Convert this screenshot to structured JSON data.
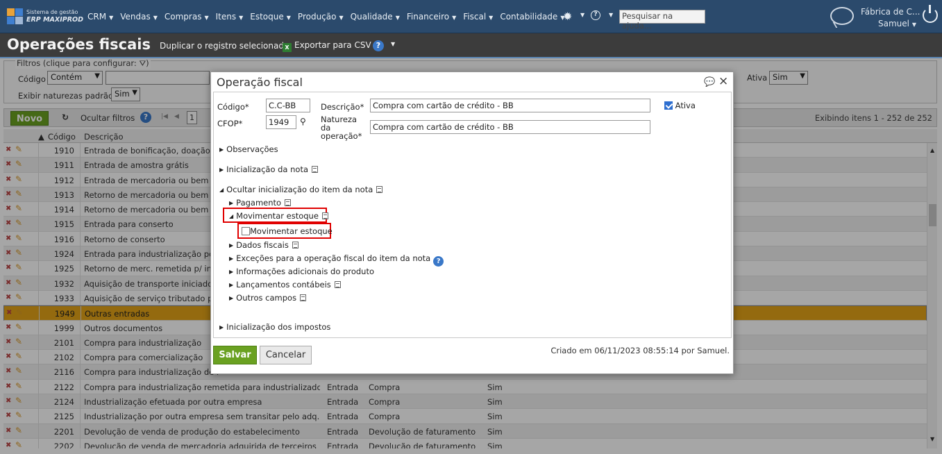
{
  "app": {
    "brand_line1": "Sistema de gestão",
    "brand_line2": "ERP MAXIPROD",
    "menu": [
      "CRM",
      "Vendas",
      "Compras",
      "Itens",
      "Estoque",
      "Produção",
      "Qualidade",
      "Financeiro",
      "Fiscal",
      "Contabilidade"
    ],
    "search_placeholder": "Pesquisar na ajuda...",
    "company": "Fábrica de C...",
    "user": "Samuel"
  },
  "page": {
    "title": "Operações fiscais",
    "duplicate_label": "Duplicar o registro selecionado",
    "export_label": "Exportar para CSV"
  },
  "filters": {
    "legend": "Filtros (clique para configurar:",
    "codigo_label": "Código",
    "codigo_op": "Contém",
    "naturezas_label": "Exibir naturezas padrão",
    "naturezas_value": "Sim",
    "ativa_label": "Ativa",
    "ativa_value": "Sim"
  },
  "toolbar": {
    "novo": "Novo",
    "hide_filters": "Ocultar filtros",
    "page": "1",
    "showing": "Exibindo itens 1 - 252 de 252"
  },
  "table": {
    "col_codigo": "Código",
    "col_descricao": "Descrição",
    "rows": [
      {
        "codigo": "1910",
        "descricao": "Entrada de bonificação, doação ou",
        "tipo": "",
        "natureza": "",
        "padrao": ""
      },
      {
        "codigo": "1911",
        "descricao": "Entrada de amostra grátis",
        "tipo": "",
        "natureza": "",
        "padrao": ""
      },
      {
        "codigo": "1912",
        "descricao": "Entrada de mercadoria ou bem re",
        "tipo": "",
        "natureza": "",
        "padrao": ""
      },
      {
        "codigo": "1913",
        "descricao": "Retorno de mercadoria ou bem re",
        "tipo": "",
        "natureza": "",
        "padrao": ""
      },
      {
        "codigo": "1914",
        "descricao": "Retorno de mercadoria ou bem re",
        "tipo": "",
        "natureza": "",
        "padrao": ""
      },
      {
        "codigo": "1915",
        "descricao": "Entrada para conserto",
        "tipo": "",
        "natureza": "",
        "padrao": ""
      },
      {
        "codigo": "1916",
        "descricao": "Retorno de conserto",
        "tipo": "",
        "natureza": "",
        "padrao": ""
      },
      {
        "codigo": "1924",
        "descricao": "Entrada para industrialização por",
        "tipo": "",
        "natureza": "",
        "padrao": ""
      },
      {
        "codigo": "1925",
        "descricao": "Retorno de merc. remetida p/ indu",
        "tipo": "",
        "natureza": "",
        "padrao": ""
      },
      {
        "codigo": "1932",
        "descricao": "Aquisição de transporte iniciado e",
        "tipo": "",
        "natureza": "",
        "padrao": ""
      },
      {
        "codigo": "1933",
        "descricao": "Aquisição de serviço tributado pel",
        "tipo": "",
        "natureza": "",
        "padrao": ""
      },
      {
        "codigo": "1949",
        "descricao": "Outras entradas",
        "tipo": "",
        "natureza": "",
        "padrao": ""
      },
      {
        "codigo": "1999",
        "descricao": "Outros documentos",
        "tipo": "",
        "natureza": "",
        "padrao": ""
      },
      {
        "codigo": "2101",
        "descricao": "Compra para industrialização",
        "tipo": "",
        "natureza": "",
        "padrao": ""
      },
      {
        "codigo": "2102",
        "descricao": "Compra para comercialização",
        "tipo": "",
        "natureza": "",
        "padrao": ""
      },
      {
        "codigo": "2116",
        "descricao": "Compra para industrialização de r",
        "tipo": "",
        "natureza": "",
        "padrao": ""
      },
      {
        "codigo": "2122",
        "descricao": "Compra para industrialização remetida para industrializador",
        "tipo": "Entrada",
        "natureza": "Compra",
        "padrao": "Sim"
      },
      {
        "codigo": "2124",
        "descricao": "Industrialização efetuada por outra empresa",
        "tipo": "Entrada",
        "natureza": "Compra",
        "padrao": "Sim"
      },
      {
        "codigo": "2125",
        "descricao": "Industrialização por outra empresa sem transitar pelo adq.",
        "tipo": "Entrada",
        "natureza": "Compra",
        "padrao": "Sim"
      },
      {
        "codigo": "2201",
        "descricao": "Devolução de venda de produção do estabelecimento",
        "tipo": "Entrada",
        "natureza": "Devolução de faturamento",
        "padrao": "Sim"
      },
      {
        "codigo": "2202",
        "descricao": "Devolução de venda de mercadoria adquirida de terceiros",
        "tipo": "Entrada",
        "natureza": "Devolução de faturamento",
        "padrao": "Sim"
      }
    ]
  },
  "modal": {
    "title": "Operação fiscal",
    "codigo_label": "Código*",
    "codigo_value": "C.C-BB",
    "descricao_label": "Descrição*",
    "descricao_value": "Compra com cartão de crédito - BB",
    "ativa_label": "Ativa",
    "cfop_label": "CFOP*",
    "cfop_value": "1949",
    "natureza_label_1": "Natureza",
    "natureza_label_2": "da",
    "natureza_label_3": "operação*",
    "natureza_value": "Compra com cartão de crédito - BB",
    "sections": {
      "observacoes": "Observações",
      "inicializacao_nota": "Inicialização da nota",
      "ocultar_item": "Ocultar inicialização do item da nota",
      "pagamento": "Pagamento",
      "movimentar_estoque": "Movimentar estoque",
      "movimentar_checkbox": "Movimentar estoque",
      "dados_fiscais": "Dados fiscais",
      "excecoes": "Exceções para a operação fiscal do item da nota",
      "info_adicionais": "Informações adicionais do produto",
      "lancamentos": "Lançamentos contábeis",
      "outros_campos": "Outros campos",
      "inicializacao_impostos": "Inicialização dos impostos"
    },
    "save": "Salvar",
    "cancel": "Cancelar",
    "created": "Criado em 06/11/2023 08:55:14 por Samuel."
  }
}
